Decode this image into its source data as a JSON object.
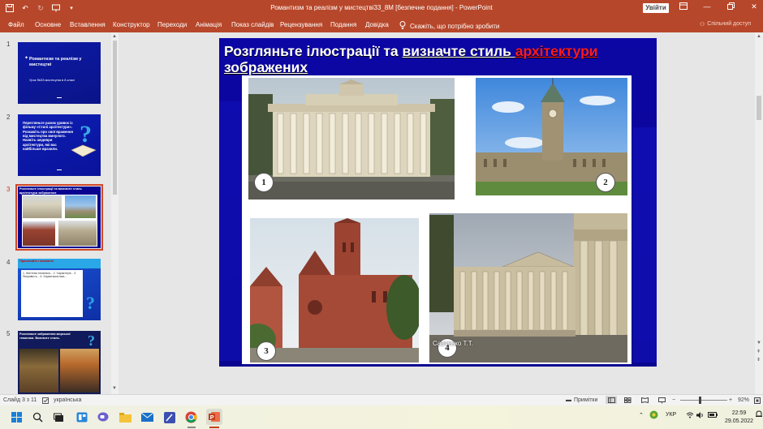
{
  "titlebar": {
    "doc_title": "Романтизм та реалізм у мистецтві33_8М [безпечне подання]  -  PowerPoint",
    "signin_label": "Увійти"
  },
  "ribbon": {
    "tabs": [
      "Файл",
      "Основне",
      "Вставлення",
      "Конструктор",
      "Переходи",
      "Анімація",
      "Показ слайдів",
      "Рецензування",
      "Подання",
      "Довідка"
    ],
    "tell_me": "Скажіть, що потрібно зробити",
    "share": "Спільний доступ"
  },
  "thumbnails": [
    {
      "number": "1",
      "title": "Романтизм та реалізм у мистецтві",
      "subtitle": "Урок №33 мистецтва в 8 класі"
    },
    {
      "number": "2",
      "text": "Перегляньте разом уривок із фільму «Стилі архітектури». Розкажіть про свої враження від мистецтва минулого. Назвіть шедеври архітектури, які вас найбільше вразили."
    },
    {
      "number": "3",
      "title": "Розгляньте ілюстрації та визначте стиль архітектури зображених"
    },
    {
      "number": "4",
      "title": "Прочитайте і визначте",
      "text": "1. Життєва тематика... 2. Характерні... 3. Яскравість... 4. Характеристика..."
    },
    {
      "number": "5",
      "title": "Розгляньте зображення морської тематики. Визначте стиль."
    }
  ],
  "slide": {
    "title_plain": "Розгляньте ілюстрації та ",
    "title_underlined": "визначте стиль ",
    "title_red": "архітектури",
    "title_line2": "зображених",
    "labels": [
      "1",
      "2",
      "3",
      "4"
    ],
    "watermark": "Савченко Т.Т."
  },
  "statusbar": {
    "slide_counter": "Слайд 3 з 11",
    "language": "українська",
    "notes": "Примітки",
    "zoom": "92%"
  },
  "taskbar": {
    "language": "УКР",
    "time": "22:59",
    "date": "29.05.2022"
  },
  "colors": {
    "accent": "#b7472a",
    "slide_bg": "#08008f",
    "title_red": "#ff1a1a"
  }
}
